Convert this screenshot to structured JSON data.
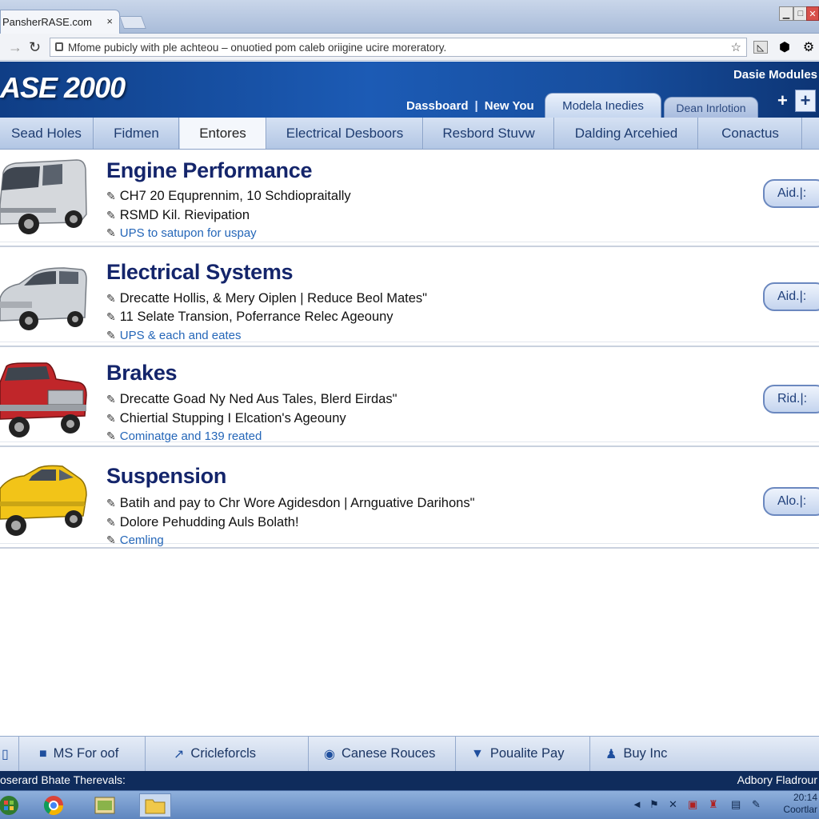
{
  "browser": {
    "tab_title": "PansherRASE.com",
    "tab_close": "×",
    "url": "Mfome pubicly with ple achteou – onuotied pom caleb oriigine ucire moreratory."
  },
  "header": {
    "logo": "ASE 2000",
    "module_label": "Dasie Modules",
    "nav": [
      "Dassboard",
      "|",
      "New You"
    ],
    "tabs": [
      "Modela Inedies",
      "Dean Inrlotion"
    ]
  },
  "main_tabs": [
    "Sead Holes",
    "Fidmen",
    "Entores",
    "Electrical Desboors",
    "Resbord Stuvw",
    "Dalding Arcehied",
    "Conactus"
  ],
  "rows": [
    {
      "title": "Engine Performance",
      "lines": [
        "CH7 20 Equprennim, 10 Schdiopraitally",
        "RSMD Kil. Rievipation"
      ],
      "link": "UPS to satupon for uspay",
      "action": "Aid.|:"
    },
    {
      "title": "Electrical Systems",
      "lines": [
        "Drecatte Hollis, & Mery Oiplen | Reduce Beol Mates\"",
        "11 Selate Transion, Poferrance Relec Ageouny"
      ],
      "link": "UPS & each and eates",
      "action": "Aid.|:"
    },
    {
      "title": "Brakes",
      "lines": [
        "Drecatte Goad Ny Ned Aus Tales, Blerd Eirdas\"",
        "Chiertial Stupping I Elcation's Ageouny"
      ],
      "link": "Cominatge and 139 reated",
      "action": "Rid.|:"
    },
    {
      "title": "Suspension",
      "lines": [
        "Batih and pay to Chr Wore Agidesdon | Arnguative Darihons\"",
        "Dolore Pehudding Auls Bolath!"
      ],
      "link": "Cemling",
      "action": "Alo.|:"
    }
  ],
  "bottom_bar": [
    "MS For oof",
    "Cricleforcls",
    "Canese Rouces",
    "Poualite Pay",
    "Buy Inc"
  ],
  "status": {
    "left": "oserard Bhate Therevals:",
    "right": "Adbory Fladrour"
  },
  "clock": {
    "line1": "20:14",
    "line2": "Coortlar"
  }
}
